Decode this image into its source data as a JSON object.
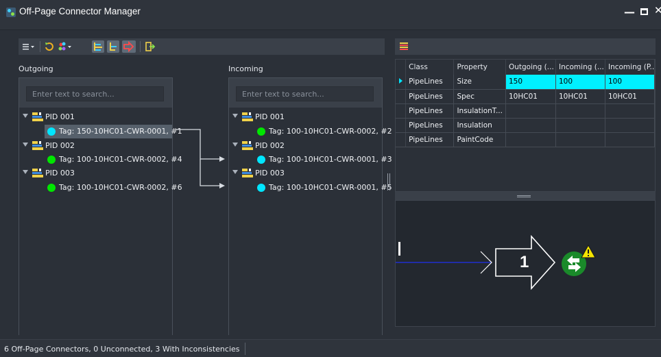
{
  "window": {
    "title": "Off-Page Connector Manager"
  },
  "panes": {
    "outgoing_label": "Outgoing",
    "incoming_label": "Incoming"
  },
  "outgoing": {
    "search_placeholder": "Enter text to search...",
    "tree": [
      {
        "pid": "PID 001",
        "tag": "Tag: 150-10HC01-CWR-0001, #1",
        "color": "#00e6ff",
        "selected": true
      },
      {
        "pid": "PID 002",
        "tag": "Tag: 100-10HC01-CWR-0002, #4",
        "color": "#00e600",
        "selected": false
      },
      {
        "pid": "PID 003",
        "tag": "Tag: 100-10HC01-CWR-0002, #6",
        "color": "#00e600",
        "selected": false
      }
    ]
  },
  "incoming": {
    "search_placeholder": "Enter text to search...",
    "tree": [
      {
        "pid": "PID 001",
        "tag": "Tag: 100-10HC01-CWR-0002, #2",
        "color": "#00e600"
      },
      {
        "pid": "PID 002",
        "tag": "Tag: 100-10HC01-CWR-0001, #3",
        "color": "#00e6ff"
      },
      {
        "pid": "PID 003",
        "tag": "Tag: 100-10HC01-CWR-0001, #5",
        "color": "#00e6ff"
      }
    ]
  },
  "grid": {
    "headers": [
      "Class",
      "Property",
      "Outgoing (...",
      "Incoming (...",
      "Incoming (P..."
    ],
    "rows": [
      {
        "cells": [
          "PipeLines",
          "Size",
          "150",
          "100",
          "100"
        ],
        "current": true
      },
      {
        "cells": [
          "PipeLines",
          "Spec",
          "10HC01",
          "10HC01",
          "10HC01"
        ],
        "current": false
      },
      {
        "cells": [
          "PipeLines",
          "InsulationT...",
          "",
          "",
          ""
        ],
        "current": false
      },
      {
        "cells": [
          "PipeLines",
          "Insulation",
          "",
          "",
          ""
        ],
        "current": false
      },
      {
        "cells": [
          "PipeLines",
          "PaintCode",
          "",
          "",
          ""
        ],
        "current": false
      }
    ],
    "highlight_color": "#00f0ff"
  },
  "preview": {
    "connector_number": "1",
    "warning_icon": "warning-icon",
    "status_icon": "swap-arrows-icon"
  },
  "status": {
    "text": "6 Off-Page Connectors, 0 Unconnected, 3 With Inconsistencies"
  },
  "colors": {
    "accent_cyan": "#00e6ff",
    "ok_green": "#00e600",
    "warning_yellow": "#f5e400"
  },
  "icons": {
    "toolbar_left": [
      "menu-icon",
      "refresh-icon",
      "color-legend-icon",
      "expand-tree-icon",
      "collapse-tree-icon",
      "direction-arrow-icon",
      "export-icon"
    ],
    "toolbar_right": [
      "column-chooser-icon"
    ]
  }
}
